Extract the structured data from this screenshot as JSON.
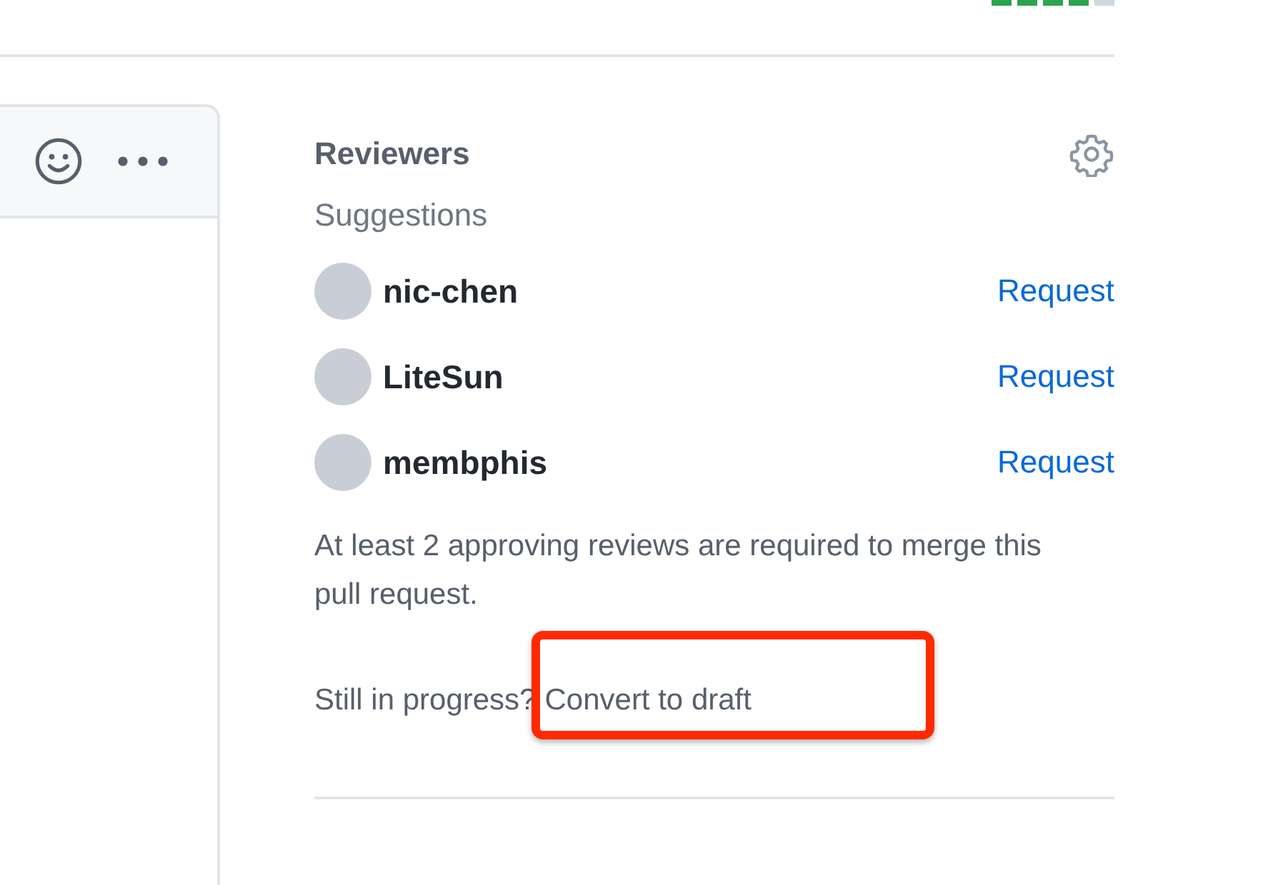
{
  "diffstat": [
    {
      "color": "#2da44e"
    },
    {
      "color": "#2da44e"
    },
    {
      "color": "#2da44e"
    },
    {
      "color": "#2da44e"
    },
    {
      "color": "#d0d7de"
    }
  ],
  "reviewers": {
    "title": "Reviewers",
    "subtitle": "Suggestions",
    "suggestions": [
      {
        "name": "nic-chen",
        "action": "Request"
      },
      {
        "name": "LiteSun",
        "action": "Request"
      },
      {
        "name": "membphis",
        "action": "Request"
      }
    ],
    "note": "At least 2 approving reviews are required to merge this pull request."
  },
  "draft": {
    "prompt": "Still in progress?",
    "link": "Convert to draft",
    "highlighted": true
  }
}
